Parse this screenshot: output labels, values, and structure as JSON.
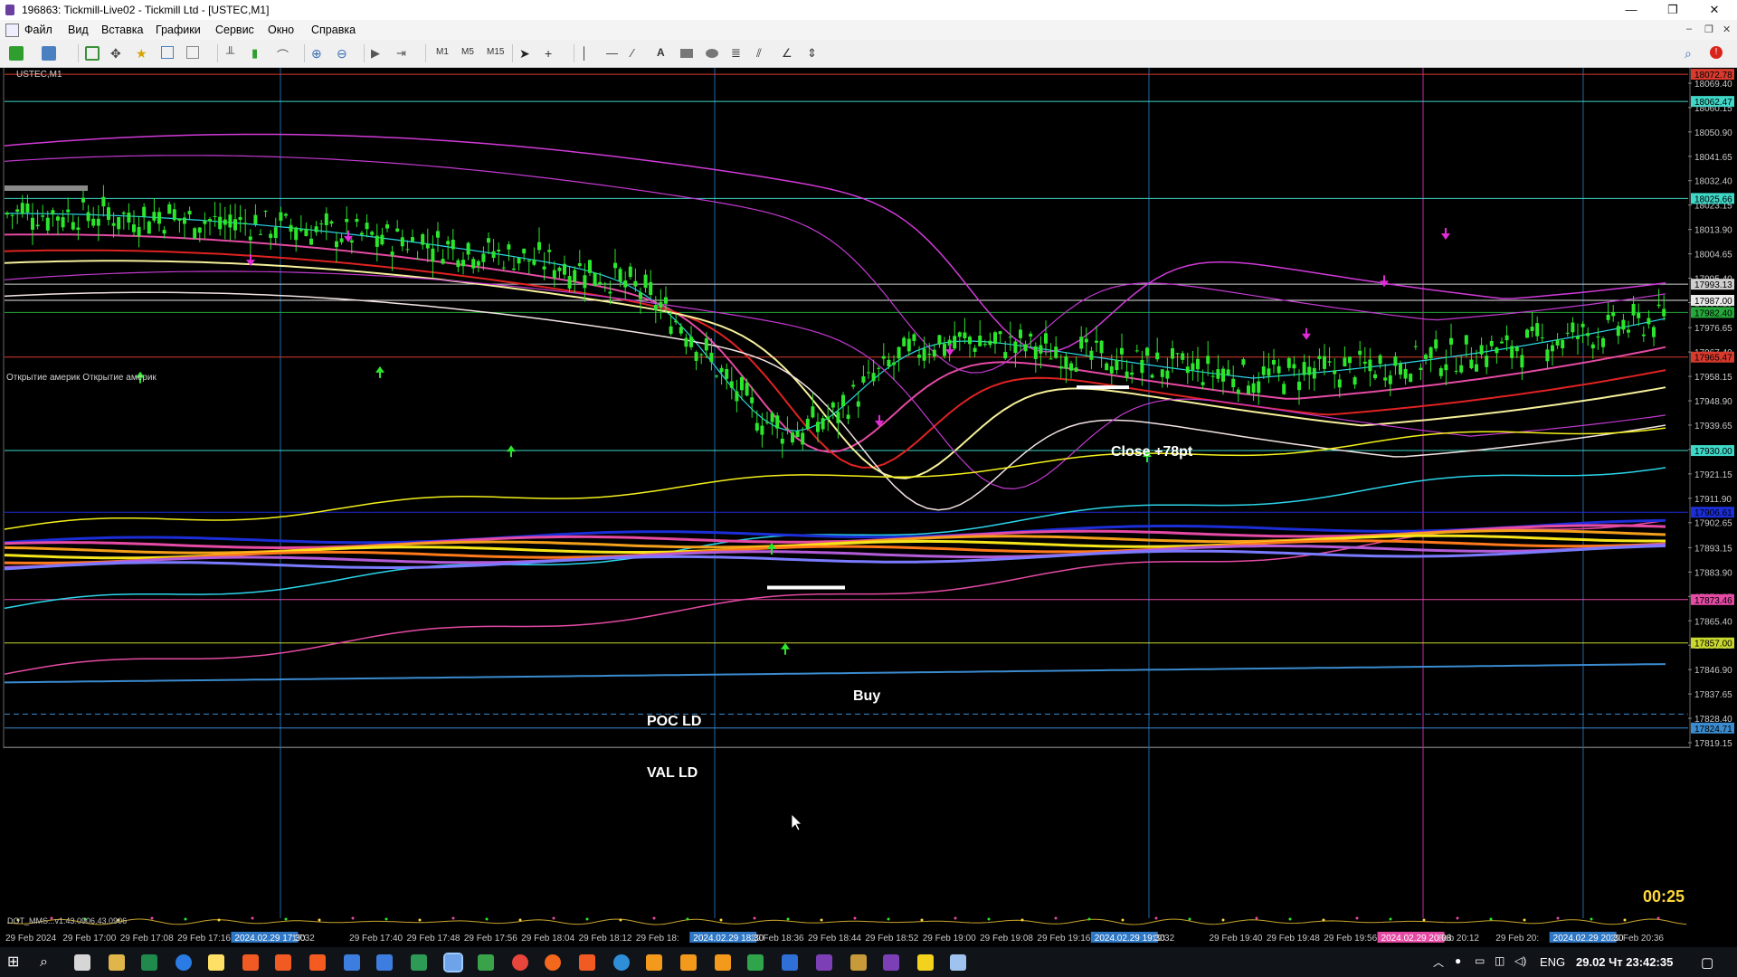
{
  "window": {
    "title": "196863: Tickmill-Live02 - Tickmill Ltd - [USTEC,M1]",
    "controls": {
      "minimize": "—",
      "restore": "❐",
      "close": "✕"
    }
  },
  "menu": {
    "items": [
      "Файл",
      "Вид",
      "Вставка",
      "Графики",
      "Сервис",
      "Окно",
      "Справка"
    ]
  },
  "toolbar": {
    "timeframes": [
      "M1",
      "M5",
      "M15"
    ]
  },
  "chart": {
    "symbol_label": "USTEC,M1",
    "indicator_label": "DOT_MMS...v1.43.0906.43.0906",
    "session_label": "Открытие америк  Открытие америк",
    "countdown": "00:25",
    "colors": {
      "background": "#000000",
      "candle": "#2ce62c",
      "text_annotation": "#ffffff",
      "countdown": "#ffd83a",
      "vline": "#1f6aa8",
      "vline_alt": "#c02ba8"
    },
    "annotations": {
      "close": "Close  +78pt",
      "buy": "Buy",
      "poc": "POC LD",
      "val": "VAL LD"
    },
    "price_axis": [
      "18078.65",
      "18069.40",
      "18060.15",
      "18050.90",
      "18041.65",
      "18032.40",
      "18023.15",
      "18013.90",
      "18004.65",
      "17995.40",
      "17986.15",
      "17976.65",
      "17967.40",
      "17958.15",
      "17948.90",
      "17939.65",
      "17930.40",
      "17921.15",
      "17911.90",
      "17902.65",
      "17893.15",
      "17883.90",
      "17874.65",
      "17865.40",
      "17856.15",
      "17846.90",
      "17837.65",
      "17828.40",
      "17819.15"
    ],
    "price_tags": [
      {
        "value": "18072.78",
        "color": "#d83a2e"
      },
      {
        "value": "18062.47",
        "color": "#3fd7c7"
      },
      {
        "value": "18025.66",
        "color": "#3fd7c7"
      },
      {
        "value": "17993.13",
        "color": "#cfcfcf"
      },
      {
        "value": "17987.00",
        "color": "#e9e9e9"
      },
      {
        "value": "17982.40",
        "color": "#26a83a"
      },
      {
        "value": "17965.47",
        "color": "#d83a2e"
      },
      {
        "value": "17930.00",
        "color": "#3fd7c7"
      },
      {
        "value": "17906.61",
        "color": "#1b2ed8"
      },
      {
        "value": "17873.46",
        "color": "#e54aa4"
      },
      {
        "value": "17857.00",
        "color": "#c8d82e"
      },
      {
        "value": "17824.71",
        "color": "#3b8bd0"
      }
    ],
    "time_axis": [
      "29 Feb 2024",
      "29 Feb 17:00",
      "29 Feb 17:08",
      "29 Feb 17:16",
      "2024.02.29 17:30",
      "17:32",
      "29 Feb 17:40",
      "29 Feb 17:48",
      "29 Feb 17:56",
      "29 Feb 18:04",
      "29 Feb 18:12",
      "29 Feb 18:",
      "2024.02.29 18:30",
      "29 Feb 18:36",
      "29 Feb 18:44",
      "29 Feb 18:52",
      "29 Feb 19:00",
      "29 Feb 19:08",
      "29 Feb 19:16",
      "2024.02.29 19:30",
      "19:32",
      "29 Feb 19:40",
      "29 Feb 19:48",
      "29 Feb 19:56",
      "2024.02.29 20:08",
      "Feb 20:12",
      "29 Feb 20:",
      "2024.02.29 20:30",
      "29 Feb 20:36"
    ]
  },
  "taskbar": {
    "language": "ENG",
    "datetime": "29.02 Чт 23:42:35"
  }
}
